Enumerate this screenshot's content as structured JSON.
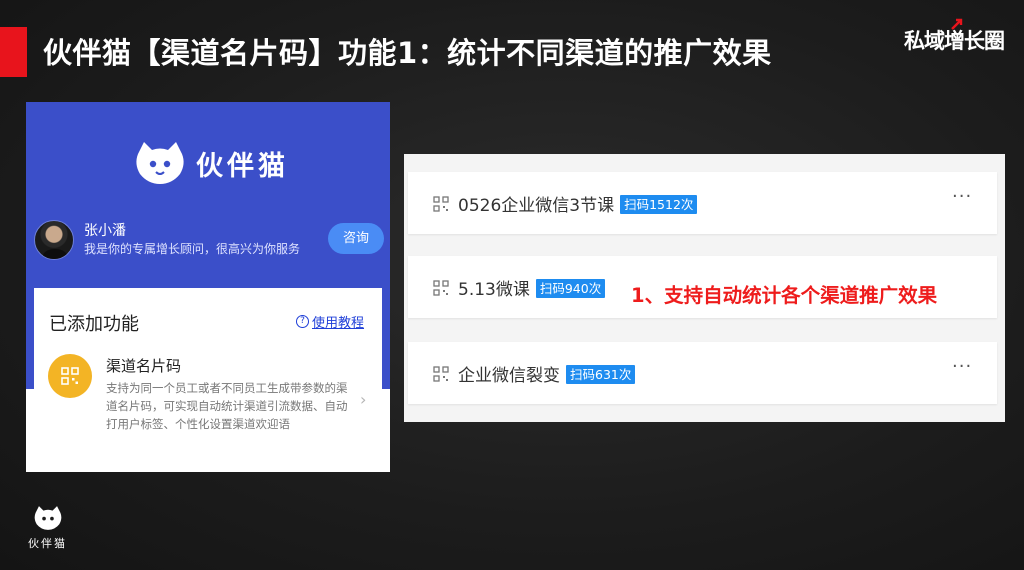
{
  "slide": {
    "title": "伙伴猫【渠道名片码】功能1：统计不同渠道的推广效果",
    "brand_logo": "私域增长圈",
    "annotation": "1、支持自动统计各个渠道推广效果",
    "accent_color": "#e8141c",
    "annotation_color": "#ee1c1c"
  },
  "phone": {
    "header_color": "#3b4fc9",
    "app_name": "伙伴猫",
    "advisor": {
      "name": "张小潘",
      "description": "我是你的专属增长顾问，很高兴为你服务",
      "consult_label": "咨询"
    },
    "card": {
      "title": "已添加功能",
      "tutorial_label": "使用教程",
      "function_name": "渠道名片码",
      "function_desc": "支持为同一个员工或者不同员工生成带参数的渠道名片码，可实现自动统计渠道引流数据、自动打用户标签、个性化设置渠道欢迎语",
      "icon": "qr-code-icon"
    }
  },
  "channels": [
    {
      "name": "0526企业微信3节课",
      "scans": "扫码1512次",
      "more": "···"
    },
    {
      "name": "5.13微课",
      "scans": "扫码940次",
      "more": ""
    },
    {
      "name": "企业微信裂变",
      "scans": "扫码631次",
      "more": "···"
    }
  ],
  "footer": {
    "logo_name": "伙伴猫"
  }
}
